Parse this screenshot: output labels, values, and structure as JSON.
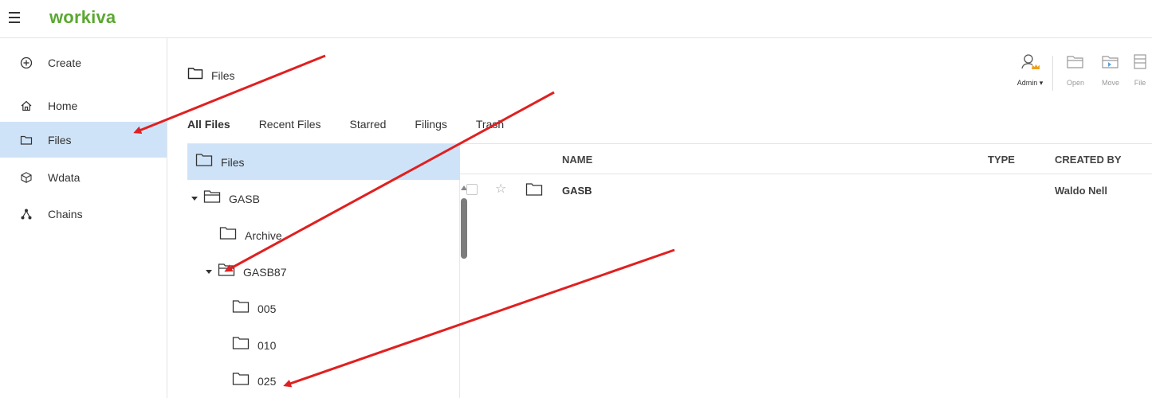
{
  "app": {
    "logo": "workiva"
  },
  "sidebar": {
    "items": [
      {
        "label": "Create",
        "icon": "plus-circle-icon"
      },
      {
        "label": "Home",
        "icon": "home-icon"
      },
      {
        "label": "Files",
        "icon": "folder-icon",
        "active": true
      },
      {
        "label": "Wdata",
        "icon": "cube-icon"
      },
      {
        "label": "Chains",
        "icon": "chain-nodes-icon"
      }
    ]
  },
  "main": {
    "title": "Files"
  },
  "toolbar": {
    "buttons": [
      {
        "label": "Admin",
        "icon": "admin-user-icon"
      },
      {
        "label": "Open",
        "icon": "open-folder-icon"
      },
      {
        "label": "Move",
        "icon": "move-folder-icon"
      },
      {
        "label": "File",
        "icon": "file-icon"
      }
    ]
  },
  "tabs": [
    "All Files",
    "Recent Files",
    "Starred",
    "Filings",
    "Trash"
  ],
  "active_tab": "All Files",
  "tree": {
    "items": [
      {
        "label": "Files",
        "level": 0,
        "expanded": null,
        "selected": true
      },
      {
        "label": "GASB",
        "level": 1,
        "expanded": true
      },
      {
        "label": "Archive",
        "level": 2,
        "expanded": null
      },
      {
        "label": "GASB87",
        "level": 1,
        "expanded": true
      },
      {
        "label": "005",
        "level": 2,
        "expanded": null
      },
      {
        "label": "010",
        "level": 2,
        "expanded": null
      },
      {
        "label": "025",
        "level": 2,
        "expanded": null
      }
    ]
  },
  "list": {
    "columns": [
      "NAME",
      "TYPE",
      "CREATED BY"
    ],
    "rows": [
      {
        "name": "GASB",
        "type": "",
        "created_by": "Waldo Nell",
        "starred": false,
        "checked": false
      }
    ]
  },
  "colors": {
    "brand": "#5aa832",
    "selection": "#cfe3f8",
    "annotation_arrow": "#e02020",
    "admin_crown": "#f0a020"
  }
}
